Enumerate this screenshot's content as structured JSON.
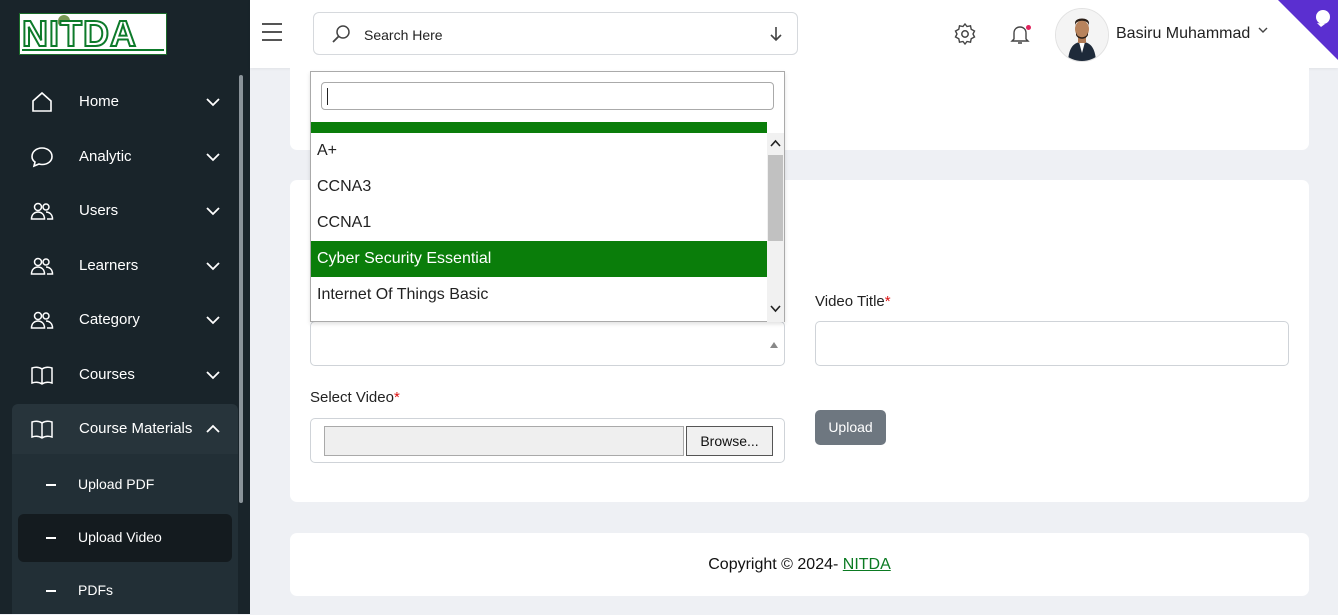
{
  "brand": {
    "logo_text": "NITDA"
  },
  "sidebar": {
    "items": [
      {
        "label": "Home",
        "icon": "home-icon"
      },
      {
        "label": "Analytic",
        "icon": "chat-bubble-icon"
      },
      {
        "label": "Users",
        "icon": "users-icon"
      },
      {
        "label": "Learners",
        "icon": "users-icon"
      },
      {
        "label": "Category",
        "icon": "users-icon"
      },
      {
        "label": "Courses",
        "icon": "book-icon"
      },
      {
        "label": "Course Materials",
        "icon": "book-icon",
        "expanded": true
      }
    ],
    "sub_items": [
      {
        "label": "Upload PDF"
      },
      {
        "label": "Upload Video",
        "active": true
      },
      {
        "label": "PDFs"
      }
    ]
  },
  "header": {
    "search_placeholder": "Search Here",
    "user_name": "Basiru Muhammad"
  },
  "form": {
    "video_title_label": "Video Title",
    "select_video_label": "Select Video",
    "required_mark": "*",
    "browse_label": "Browse...",
    "upload_label": "Upload"
  },
  "dropdown": {
    "search_value": "",
    "options": [
      {
        "label": "A+",
        "selected": false
      },
      {
        "label": "CCNA3",
        "selected": false
      },
      {
        "label": "CCNA1",
        "selected": false
      },
      {
        "label": "Cyber Security Essential",
        "selected": true
      },
      {
        "label": "Internet Of Things Basic",
        "selected": false
      }
    ]
  },
  "footer": {
    "copyright_text": "Copyright © 2024- ",
    "link_text": "NITDA"
  },
  "colors": {
    "sidebar_bg": "#19242a",
    "accent_green": "#0a7d0a",
    "upload_button": "#6e7780",
    "ribbon": "#5b2fd0"
  }
}
